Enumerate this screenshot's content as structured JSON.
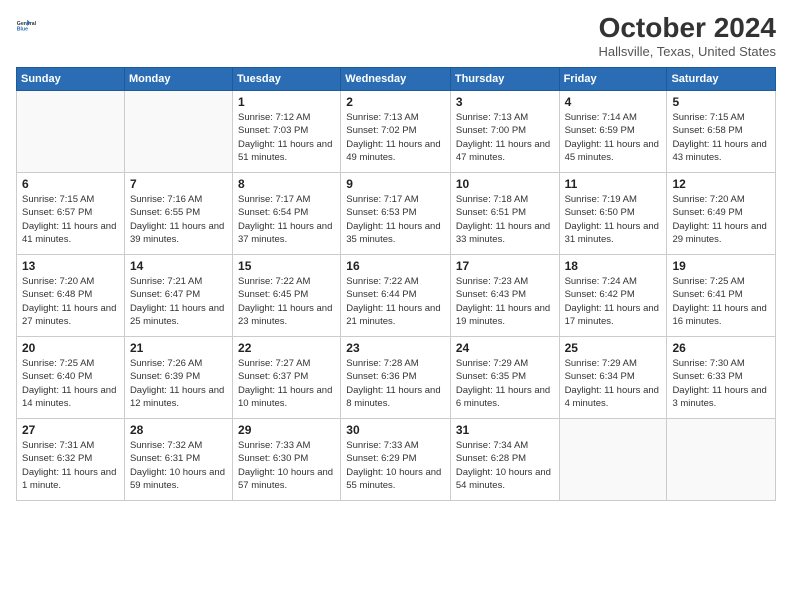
{
  "logo": {
    "line1": "General",
    "line2": "Blue"
  },
  "title": "October 2024",
  "location": "Hallsville, Texas, United States",
  "days_of_week": [
    "Sunday",
    "Monday",
    "Tuesday",
    "Wednesday",
    "Thursday",
    "Friday",
    "Saturday"
  ],
  "weeks": [
    [
      {
        "day": "",
        "info": ""
      },
      {
        "day": "",
        "info": ""
      },
      {
        "day": "1",
        "info": "Sunrise: 7:12 AM\nSunset: 7:03 PM\nDaylight: 11 hours and 51 minutes."
      },
      {
        "day": "2",
        "info": "Sunrise: 7:13 AM\nSunset: 7:02 PM\nDaylight: 11 hours and 49 minutes."
      },
      {
        "day": "3",
        "info": "Sunrise: 7:13 AM\nSunset: 7:00 PM\nDaylight: 11 hours and 47 minutes."
      },
      {
        "day": "4",
        "info": "Sunrise: 7:14 AM\nSunset: 6:59 PM\nDaylight: 11 hours and 45 minutes."
      },
      {
        "day": "5",
        "info": "Sunrise: 7:15 AM\nSunset: 6:58 PM\nDaylight: 11 hours and 43 minutes."
      }
    ],
    [
      {
        "day": "6",
        "info": "Sunrise: 7:15 AM\nSunset: 6:57 PM\nDaylight: 11 hours and 41 minutes."
      },
      {
        "day": "7",
        "info": "Sunrise: 7:16 AM\nSunset: 6:55 PM\nDaylight: 11 hours and 39 minutes."
      },
      {
        "day": "8",
        "info": "Sunrise: 7:17 AM\nSunset: 6:54 PM\nDaylight: 11 hours and 37 minutes."
      },
      {
        "day": "9",
        "info": "Sunrise: 7:17 AM\nSunset: 6:53 PM\nDaylight: 11 hours and 35 minutes."
      },
      {
        "day": "10",
        "info": "Sunrise: 7:18 AM\nSunset: 6:51 PM\nDaylight: 11 hours and 33 minutes."
      },
      {
        "day": "11",
        "info": "Sunrise: 7:19 AM\nSunset: 6:50 PM\nDaylight: 11 hours and 31 minutes."
      },
      {
        "day": "12",
        "info": "Sunrise: 7:20 AM\nSunset: 6:49 PM\nDaylight: 11 hours and 29 minutes."
      }
    ],
    [
      {
        "day": "13",
        "info": "Sunrise: 7:20 AM\nSunset: 6:48 PM\nDaylight: 11 hours and 27 minutes."
      },
      {
        "day": "14",
        "info": "Sunrise: 7:21 AM\nSunset: 6:47 PM\nDaylight: 11 hours and 25 minutes."
      },
      {
        "day": "15",
        "info": "Sunrise: 7:22 AM\nSunset: 6:45 PM\nDaylight: 11 hours and 23 minutes."
      },
      {
        "day": "16",
        "info": "Sunrise: 7:22 AM\nSunset: 6:44 PM\nDaylight: 11 hours and 21 minutes."
      },
      {
        "day": "17",
        "info": "Sunrise: 7:23 AM\nSunset: 6:43 PM\nDaylight: 11 hours and 19 minutes."
      },
      {
        "day": "18",
        "info": "Sunrise: 7:24 AM\nSunset: 6:42 PM\nDaylight: 11 hours and 17 minutes."
      },
      {
        "day": "19",
        "info": "Sunrise: 7:25 AM\nSunset: 6:41 PM\nDaylight: 11 hours and 16 minutes."
      }
    ],
    [
      {
        "day": "20",
        "info": "Sunrise: 7:25 AM\nSunset: 6:40 PM\nDaylight: 11 hours and 14 minutes."
      },
      {
        "day": "21",
        "info": "Sunrise: 7:26 AM\nSunset: 6:39 PM\nDaylight: 11 hours and 12 minutes."
      },
      {
        "day": "22",
        "info": "Sunrise: 7:27 AM\nSunset: 6:37 PM\nDaylight: 11 hours and 10 minutes."
      },
      {
        "day": "23",
        "info": "Sunrise: 7:28 AM\nSunset: 6:36 PM\nDaylight: 11 hours and 8 minutes."
      },
      {
        "day": "24",
        "info": "Sunrise: 7:29 AM\nSunset: 6:35 PM\nDaylight: 11 hours and 6 minutes."
      },
      {
        "day": "25",
        "info": "Sunrise: 7:29 AM\nSunset: 6:34 PM\nDaylight: 11 hours and 4 minutes."
      },
      {
        "day": "26",
        "info": "Sunrise: 7:30 AM\nSunset: 6:33 PM\nDaylight: 11 hours and 3 minutes."
      }
    ],
    [
      {
        "day": "27",
        "info": "Sunrise: 7:31 AM\nSunset: 6:32 PM\nDaylight: 11 hours and 1 minute."
      },
      {
        "day": "28",
        "info": "Sunrise: 7:32 AM\nSunset: 6:31 PM\nDaylight: 10 hours and 59 minutes."
      },
      {
        "day": "29",
        "info": "Sunrise: 7:33 AM\nSunset: 6:30 PM\nDaylight: 10 hours and 57 minutes."
      },
      {
        "day": "30",
        "info": "Sunrise: 7:33 AM\nSunset: 6:29 PM\nDaylight: 10 hours and 55 minutes."
      },
      {
        "day": "31",
        "info": "Sunrise: 7:34 AM\nSunset: 6:28 PM\nDaylight: 10 hours and 54 minutes."
      },
      {
        "day": "",
        "info": ""
      },
      {
        "day": "",
        "info": ""
      }
    ]
  ]
}
